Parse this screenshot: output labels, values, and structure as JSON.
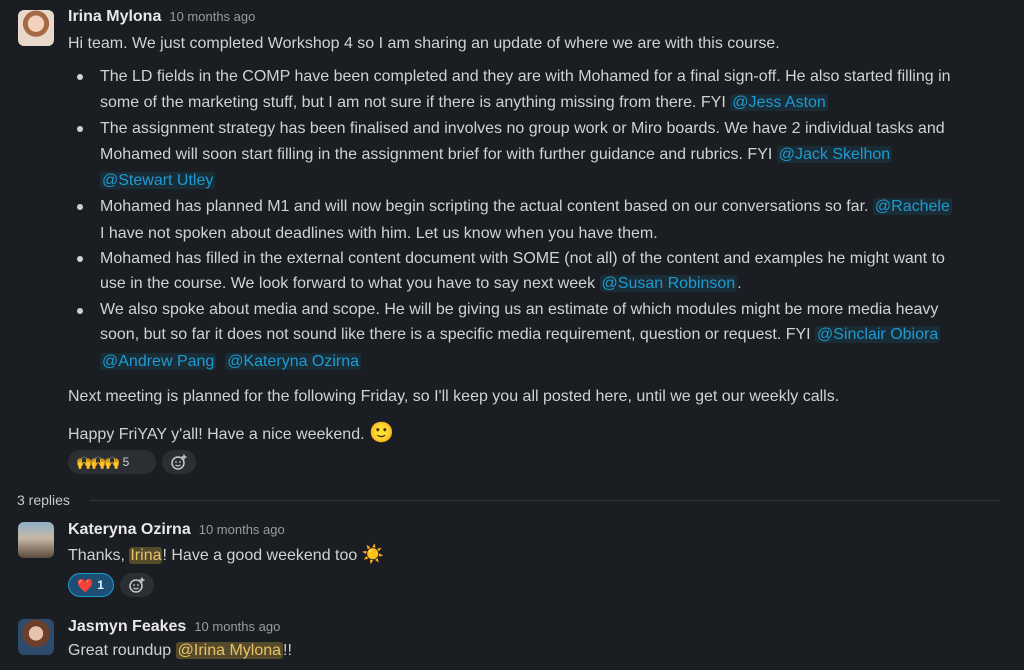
{
  "main_message": {
    "author": "Irina Mylona",
    "time": "10 months ago",
    "intro": "Hi team. We just completed Workshop 4 so I am sharing an update of where we are with this course.",
    "bullets": [
      {
        "l1": "The LD fields in the COMP have been completed and they are with Mohamed for a final sign-off. He also started filling in",
        "l2": "some of the marketing stuff, but I am not sure if there is anything missing from there. FYI ",
        "m1": "@Jess Aston"
      },
      {
        "l1": "The assignment strategy has been finalised and involves no group work or Miro boards. We have 2 individual tasks and",
        "l2": "Mohamed will soon start filling in the assignment brief for with further guidance and rubrics. FYI ",
        "m1": "@Jack Skelhon",
        "m2": "@Stewart Utley"
      },
      {
        "l1": "Mohamed has planned M1 and will now begin scripting the actual content based on our conversations so far. ",
        "m1": "@Rachele",
        "l2": "I have not spoken about deadlines with him. Let us know when you have them."
      },
      {
        "l1": "Mohamed has filled in the external content document with SOME (not all) of the content and examples he might want to",
        "l2": "use in the course. We look forward to what you have to say next week ",
        "m1": "@Susan Robinson",
        "after": "."
      },
      {
        "l1": "We also spoke about media and scope. He will be giving us an estimate of which modules might be more media heavy",
        "l2": "soon, but so far it does not sound like there is a specific media requirement, question or request. FYI ",
        "m1": "@Sinclair Obiora",
        "m2": "@Andrew Pang",
        "m3": "@Kateryna Ozirna"
      }
    ],
    "next_meeting": "Next meeting is planned for the following Friday, so I'll keep you all posted here, until we get our weekly calls.",
    "closing": "Happy FriYAY y'all! Have a nice weekend. ",
    "closing_emoji": "🙂",
    "reaction_emojis": "🙌🙌🙌",
    "reaction_count": "5"
  },
  "thread": {
    "replies_label": "3 replies",
    "replies": [
      {
        "author": "Kateryna Ozirna",
        "time": "10 months ago",
        "pre": "Thanks, ",
        "highlight": "Irina",
        "post": "! Have a good weekend too ",
        "emoji": "☀️",
        "reaction_emoji": "❤️",
        "reaction_count": "1"
      },
      {
        "author": "Jasmyn Feakes",
        "time": "10 months ago",
        "pre": "Great roundup ",
        "mention": "@Irina Mylona",
        "post": "!!"
      }
    ]
  },
  "icons": {
    "add_reaction": "add-reaction-icon"
  },
  "colors": {
    "background": "#1a1d21",
    "mention": "#1d9bd1",
    "self_mention_bg": "#f2c744"
  }
}
